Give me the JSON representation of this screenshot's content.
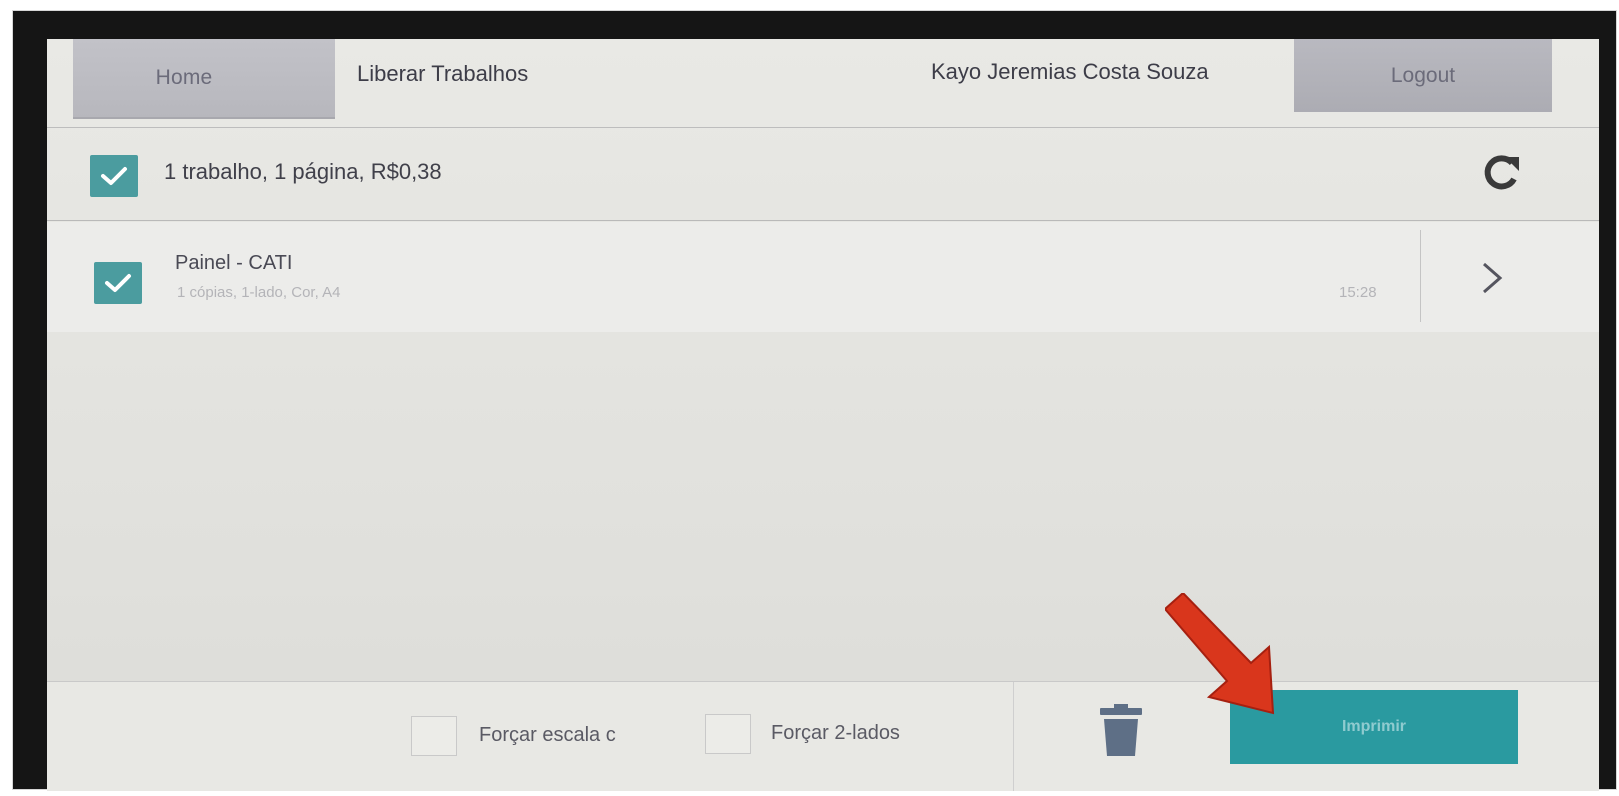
{
  "header": {
    "home_label": "Home",
    "title": "Liberar Trabalhos",
    "user_name": "Kayo Jeremias Costa Souza",
    "logout_label": "Logout"
  },
  "summary": {
    "checked": true,
    "text": "1 trabalho, 1 página,  R$0,38"
  },
  "jobs": [
    {
      "checked": true,
      "name": "Painel - CATI",
      "details": "1 cópias, 1-lado, Cor, A4",
      "time": "15:28"
    }
  ],
  "footer": {
    "option_scale_label": "Forçar escala c",
    "option_duplex_label": "Forçar 2-lados",
    "print_label": "Imprimir"
  },
  "icons": {
    "checkbox": "check-icon",
    "refresh": "refresh-icon",
    "chevron": "chevron-right-icon",
    "trash": "trash-icon",
    "annotation": "red-arrow-icon"
  },
  "colors": {
    "accent": "#2a9aa0",
    "checkbox": "#4b9c9f",
    "arrow": "#d9361c"
  }
}
